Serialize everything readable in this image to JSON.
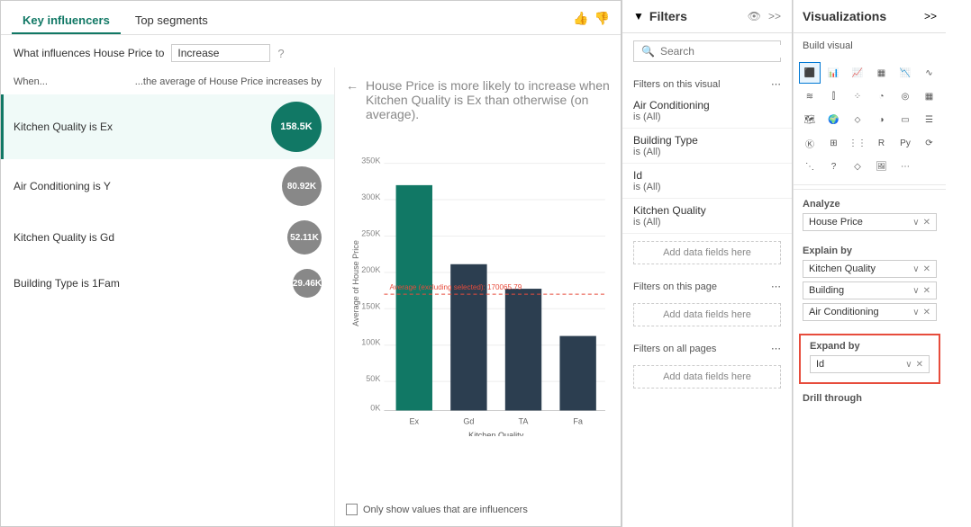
{
  "tabs": {
    "key_influencers": "Key influencers",
    "top_segments": "Top segments"
  },
  "header": {
    "prefix": "What influences House Price to",
    "select_value": "Increase",
    "question_mark": "?"
  },
  "columns": {
    "when": "When...",
    "avg": "...the average of House Price increases by"
  },
  "influencers": [
    {
      "label": "Kitchen Quality is Ex",
      "value": "158.5K",
      "size": 56,
      "color": "#117865",
      "selected": true
    },
    {
      "label": "Air Conditioning is Y",
      "value": "80.92K",
      "size": 44,
      "color": "#888",
      "selected": false
    },
    {
      "label": "Kitchen Quality is Gd",
      "value": "52.11K",
      "size": 38,
      "color": "#888",
      "selected": false
    },
    {
      "label": "Building Type is 1Fam",
      "value": "29.46K",
      "size": 32,
      "color": "#888",
      "selected": false
    }
  ],
  "chart": {
    "title": "House Price is more likely to increase when Kitchen Quality is Ex than otherwise (on average).",
    "avg_line_label": "Average (excluding selected): 170065.79",
    "x_label": "Kitchen Quality",
    "y_label": "Average of House Price",
    "y_ticks": [
      "350K",
      "300K",
      "250K",
      "200K",
      "150K",
      "100K",
      "50K",
      "0K"
    ],
    "bars": [
      {
        "label": "Ex",
        "value": 328000,
        "color": "#117865"
      },
      {
        "label": "Gd",
        "value": 213000,
        "color": "#2c3e50"
      },
      {
        "label": "TA",
        "value": 178000,
        "color": "#2c3e50"
      },
      {
        "label": "Fa",
        "value": 108000,
        "color": "#2c3e50"
      }
    ],
    "max_value": 360000,
    "footer_checkbox": "Only show values that are influencers"
  },
  "filters": {
    "title": "Filters",
    "sections": {
      "on_visual": "Filters on this visual",
      "on_page": "Filters on this page",
      "on_all_pages": "Filters on all pages"
    },
    "visual_filters": [
      {
        "name": "Air Conditioning",
        "value": "is (All)"
      },
      {
        "name": "Building Type",
        "value": "is (All)"
      },
      {
        "name": "Id",
        "value": "is (All)"
      },
      {
        "name": "Kitchen Quality",
        "value": "is (All)"
      }
    ],
    "add_fields": "Add data fields here",
    "search_placeholder": "Search"
  },
  "viz": {
    "title": "Visualizations",
    "build_visual_label": "Build visual",
    "analyze_label": "Analyze",
    "analyze_field": "House Price",
    "explain_by_label": "Explain by",
    "explain_fields": [
      "Kitchen Quality",
      "Building",
      "Air Conditioning"
    ],
    "expand_by_label": "Expand by",
    "expand_field": "Id",
    "drill_label": "Drill through"
  }
}
